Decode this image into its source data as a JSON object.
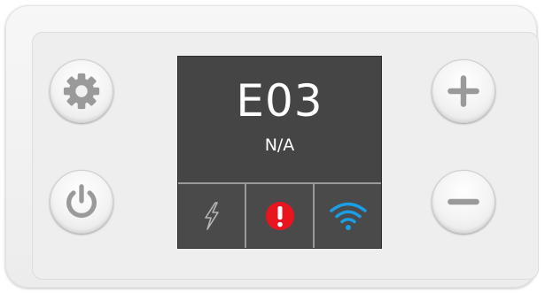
{
  "display": {
    "code": "E03",
    "subtext": "N/A"
  },
  "buttons": {
    "settings": "gear-icon",
    "power": "power-icon",
    "plus": "plus-icon",
    "minus": "minus-icon"
  },
  "status_icons": {
    "power": "lightning-bolt-icon",
    "alert": "exclamation-icon",
    "wifi": "wifi-icon"
  },
  "colors": {
    "display_bg": "#454545",
    "alert_red": "#e8141e",
    "wifi_blue": "#1a9ee6",
    "icon_grey": "#9a9a9a"
  }
}
